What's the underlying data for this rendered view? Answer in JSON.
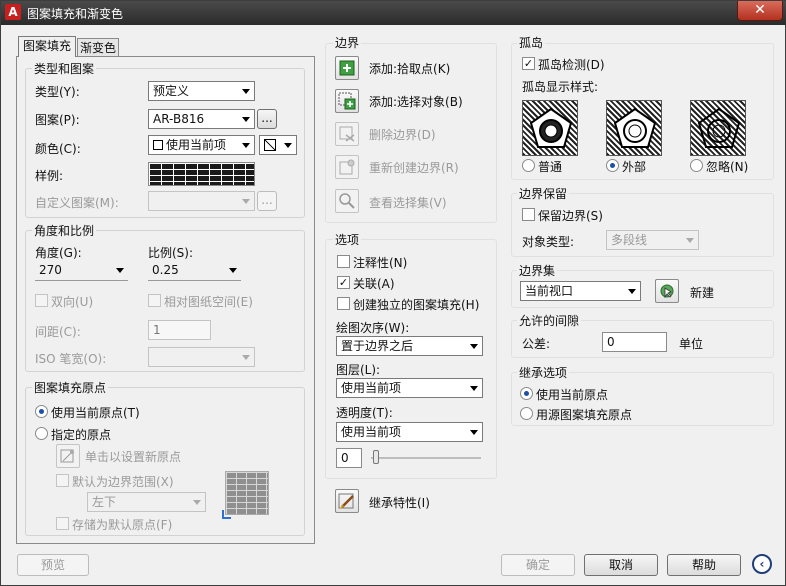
{
  "title": "图案填充和渐变色",
  "tabs": [
    "图案填充",
    "渐变色"
  ],
  "type_pattern": {
    "heading": "类型和图案",
    "type_label": "类型(Y):",
    "type_value": "预定义",
    "pattern_label": "图案(P):",
    "pattern_value": "AR-B816",
    "color_label": "颜色(C):",
    "color_value": "使用当前项",
    "swatch_label": "样例:",
    "custom_label": "自定义图案(M):",
    "ellipsis": "..."
  },
  "angle_scale": {
    "heading": "角度和比例",
    "angle_label": "角度(G):",
    "angle_value": "270",
    "scale_label": "比例(S):",
    "scale_value": "0.25",
    "double_label": "双向(U)",
    "relative_label": "相对图纸空间(E)",
    "spacing_label": "间距(C):",
    "spacing_value": "1",
    "iso_label": "ISO 笔宽(O):"
  },
  "origin": {
    "heading": "图案填充原点",
    "use_current": "使用当前原点(T)",
    "specified": "指定的原点",
    "click_set": "单击以设置新原点",
    "default_extent": "默认为边界范围(X)",
    "position_value": "左下",
    "store_default": "存储为默认原点(F)"
  },
  "boundary": {
    "heading": "边界",
    "add_pick": "添加:拾取点(K)",
    "add_select": "添加:选择对象(B)",
    "remove": "删除边界(D)",
    "recreate": "重新创建边界(R)",
    "view": "查看选择集(V)"
  },
  "options": {
    "heading": "选项",
    "annotative": "注释性(N)",
    "associative": "关联(A)",
    "separate": "创建独立的图案填充(H)",
    "draw_order_label": "绘图次序(W):",
    "draw_order_value": "置于边界之后",
    "layer_label": "图层(L):",
    "layer_value": "使用当前项",
    "transparency_label": "透明度(T):",
    "transparency_value": "使用当前项",
    "transparency_num": "0"
  },
  "inherit_props": "继承特性(I)",
  "islands": {
    "heading": "孤岛",
    "detect": "孤岛检测(D)",
    "style_label": "孤岛显示样式:",
    "normal": "普通",
    "outer": "外部",
    "ignore": "忽略(N)"
  },
  "retain": {
    "heading": "边界保留",
    "retain_label": "保留边界(S)",
    "object_type_label": "对象类型:",
    "object_type_value": "多段线"
  },
  "boundary_set": {
    "heading": "边界集",
    "value": "当前视口",
    "new_label": "新建"
  },
  "gap": {
    "heading": "允许的间隙",
    "tolerance_label": "公差:",
    "tolerance_value": "0",
    "unit": "单位"
  },
  "inherit_options": {
    "heading": "继承选项",
    "use_current": "使用当前原点",
    "use_source": "用源图案填充原点"
  },
  "footer": {
    "preview": "预览",
    "ok": "确定",
    "cancel": "取消",
    "help": "帮助"
  }
}
